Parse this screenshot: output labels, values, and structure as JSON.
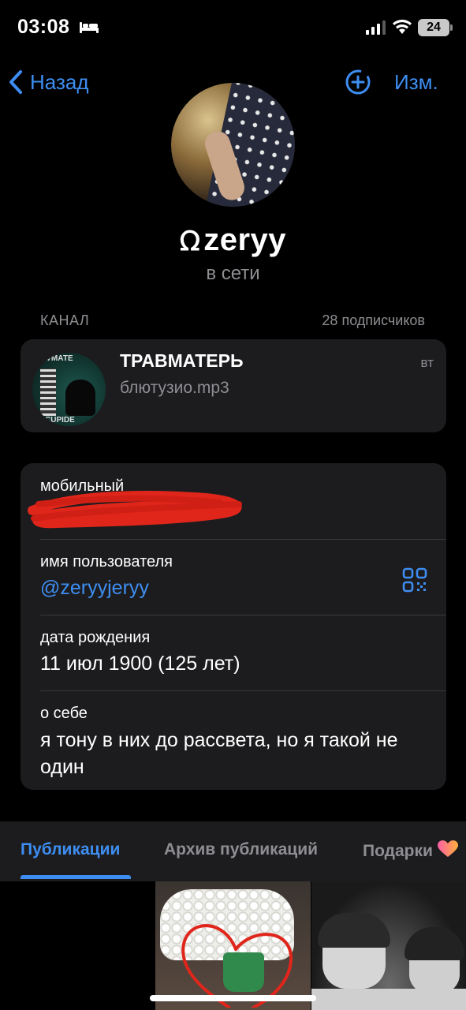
{
  "status_bar": {
    "time": "03:08",
    "battery": "24"
  },
  "nav": {
    "back_label": "Назад",
    "edit_label": "Изм."
  },
  "profile": {
    "name": "zeryy",
    "name_glyph": "ᘯ",
    "presence": "в сети"
  },
  "channel": {
    "section_label": "КАНАЛ",
    "subscribers": "28 подписчиков",
    "title": "ТРАВМАТЕРЬ",
    "subtitle": "блютузио.mp3",
    "day": "вт",
    "thumb_text_top": "ЯVМАТЕ",
    "thumb_text_bottom": "CUPIDE"
  },
  "info": {
    "mobile_label": "мобильный",
    "username_label": "имя пользователя",
    "username_value": "@zeryyjeryy",
    "birthday_label": "дата рождения",
    "birthday_value": "11 июл 1900 (125 лет)",
    "about_label": "о себе",
    "about_value": "я тону в них до рассвета, но я такой не один"
  },
  "tabs": [
    {
      "label": "Публикации",
      "active": true
    },
    {
      "label": "Архив публикаций",
      "active": false
    },
    {
      "label": "Подарки",
      "active": false
    }
  ],
  "colors": {
    "accent": "#3e8ef2",
    "card_bg": "#1c1c1e",
    "secondary_text": "#8e8e93",
    "redaction": "#e0261b"
  },
  "icons": {
    "back": "chevron-left-icon",
    "add": "add-circle-icon",
    "qr": "qr-code-icon",
    "sleep": "bed-icon",
    "gift_heart": "heart-icon"
  }
}
